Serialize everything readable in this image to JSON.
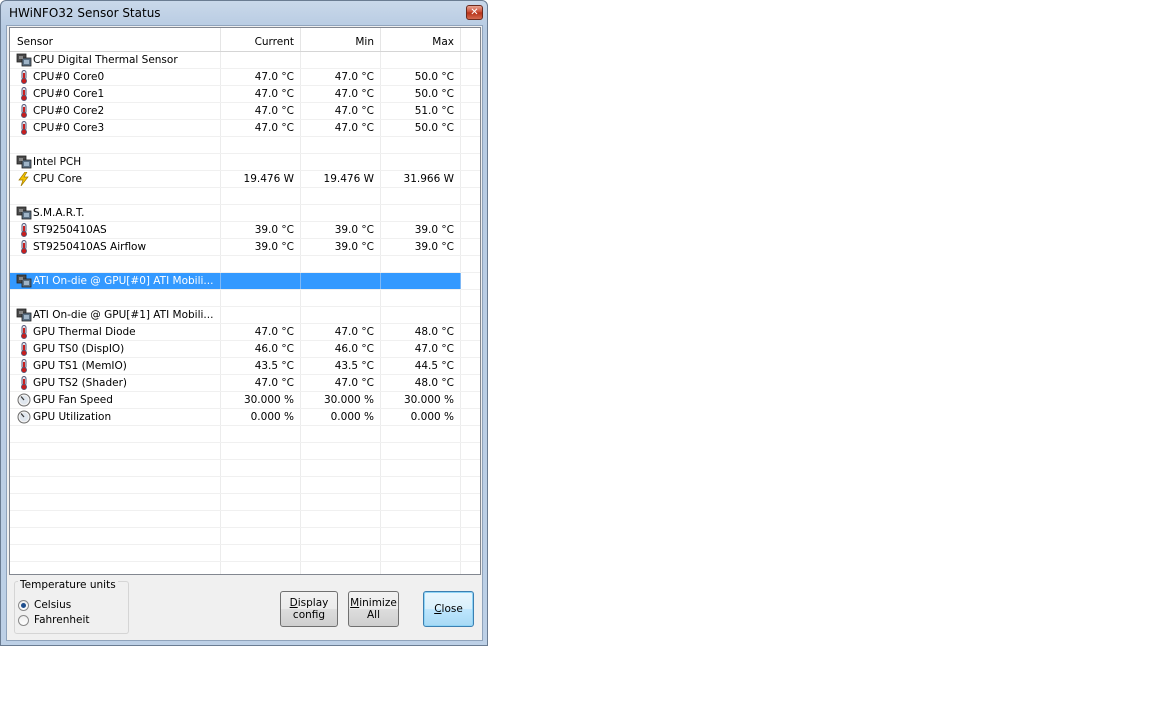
{
  "window": {
    "title": "HWiNFO32 Sensor Status",
    "close_glyph": "✕"
  },
  "columns": [
    "Sensor",
    "Current",
    "Min",
    "Max"
  ],
  "rows": [
    {
      "label": "CPU Digital Thermal Sensor",
      "icon": "chip-icon",
      "current": "",
      "min": "",
      "max": ""
    },
    {
      "label": "CPU#0 Core0",
      "icon": "thermometer-icon",
      "current": "47.0 °C",
      "min": "47.0 °C",
      "max": "50.0 °C"
    },
    {
      "label": "CPU#0 Core1",
      "icon": "thermometer-icon",
      "current": "47.0 °C",
      "min": "47.0 °C",
      "max": "50.0 °C"
    },
    {
      "label": "CPU#0 Core2",
      "icon": "thermometer-icon",
      "current": "47.0 °C",
      "min": "47.0 °C",
      "max": "51.0 °C"
    },
    {
      "label": "CPU#0 Core3",
      "icon": "thermometer-icon",
      "current": "47.0 °C",
      "min": "47.0 °C",
      "max": "50.0 °C"
    },
    {
      "label": "",
      "icon": "",
      "current": "",
      "min": "",
      "max": ""
    },
    {
      "label": "Intel PCH",
      "icon": "chip-icon",
      "current": "",
      "min": "",
      "max": ""
    },
    {
      "label": "CPU Core",
      "icon": "lightning-icon",
      "current": "19.476 W",
      "min": "19.476 W",
      "max": "31.966 W"
    },
    {
      "label": "",
      "icon": "",
      "current": "",
      "min": "",
      "max": ""
    },
    {
      "label": "S.M.A.R.T.",
      "icon": "chip-icon",
      "current": "",
      "min": "",
      "max": ""
    },
    {
      "label": "ST9250410AS",
      "icon": "thermometer-icon",
      "current": "39.0 °C",
      "min": "39.0 °C",
      "max": "39.0 °C"
    },
    {
      "label": "ST9250410AS Airflow",
      "icon": "thermometer-icon",
      "current": "39.0 °C",
      "min": "39.0 °C",
      "max": "39.0 °C"
    },
    {
      "label": "",
      "icon": "",
      "current": "",
      "min": "",
      "max": ""
    },
    {
      "label": "ATI On-die @ GPU[#0] ATI Mobili...",
      "icon": "chip-icon",
      "current": "",
      "min": "",
      "max": "",
      "selected": true
    },
    {
      "label": "",
      "icon": "",
      "current": "",
      "min": "",
      "max": ""
    },
    {
      "label": "ATI On-die @ GPU[#1] ATI Mobili...",
      "icon": "chip-icon",
      "current": "",
      "min": "",
      "max": ""
    },
    {
      "label": "GPU Thermal Diode",
      "icon": "thermometer-icon",
      "current": "47.0 °C",
      "min": "47.0 °C",
      "max": "48.0 °C"
    },
    {
      "label": "GPU TS0 (DispIO)",
      "icon": "thermometer-icon",
      "current": "46.0 °C",
      "min": "46.0 °C",
      "max": "47.0 °C"
    },
    {
      "label": "GPU TS1 (MemIO)",
      "icon": "thermometer-icon",
      "current": "43.5 °C",
      "min": "43.5 °C",
      "max": "44.5 °C"
    },
    {
      "label": "GPU TS2 (Shader)",
      "icon": "thermometer-icon",
      "current": "47.0 °C",
      "min": "47.0 °C",
      "max": "48.0 °C"
    },
    {
      "label": "GPU Fan Speed",
      "icon": "gauge-icon",
      "current": "30.000 %",
      "min": "30.000 %",
      "max": "30.000 %"
    },
    {
      "label": "GPU Utilization",
      "icon": "gauge-icon",
      "current": "0.000 %",
      "min": "0.000 %",
      "max": "0.000 %"
    },
    {
      "label": "",
      "icon": "",
      "current": "",
      "min": "",
      "max": ""
    },
    {
      "label": "",
      "icon": "",
      "current": "",
      "min": "",
      "max": ""
    },
    {
      "label": "",
      "icon": "",
      "current": "",
      "min": "",
      "max": ""
    },
    {
      "label": "",
      "icon": "",
      "current": "",
      "min": "",
      "max": ""
    },
    {
      "label": "",
      "icon": "",
      "current": "",
      "min": "",
      "max": ""
    },
    {
      "label": "",
      "icon": "",
      "current": "",
      "min": "",
      "max": ""
    },
    {
      "label": "",
      "icon": "",
      "current": "",
      "min": "",
      "max": ""
    },
    {
      "label": "",
      "icon": "",
      "current": "",
      "min": "",
      "max": ""
    },
    {
      "label": "",
      "icon": "",
      "current": "",
      "min": "",
      "max": ""
    }
  ],
  "temperature_units": {
    "legend": "Temperature units",
    "options": [
      "Celsius",
      "Fahrenheit"
    ],
    "selected": "Celsius"
  },
  "buttons": {
    "display_config": {
      "line1_prefix": "",
      "line1_accel": "D",
      "line1_rest": "isplay",
      "line2": "config"
    },
    "minimize_all": {
      "line1_prefix": "",
      "line1_accel": "M",
      "line1_rest": "inimize",
      "line2": "All"
    },
    "close": {
      "accel": "C",
      "rest": "lose"
    }
  },
  "colors": {
    "selection": "#3399ff",
    "title_bar": "#c9d8ea",
    "close_button": "#c7442b"
  }
}
